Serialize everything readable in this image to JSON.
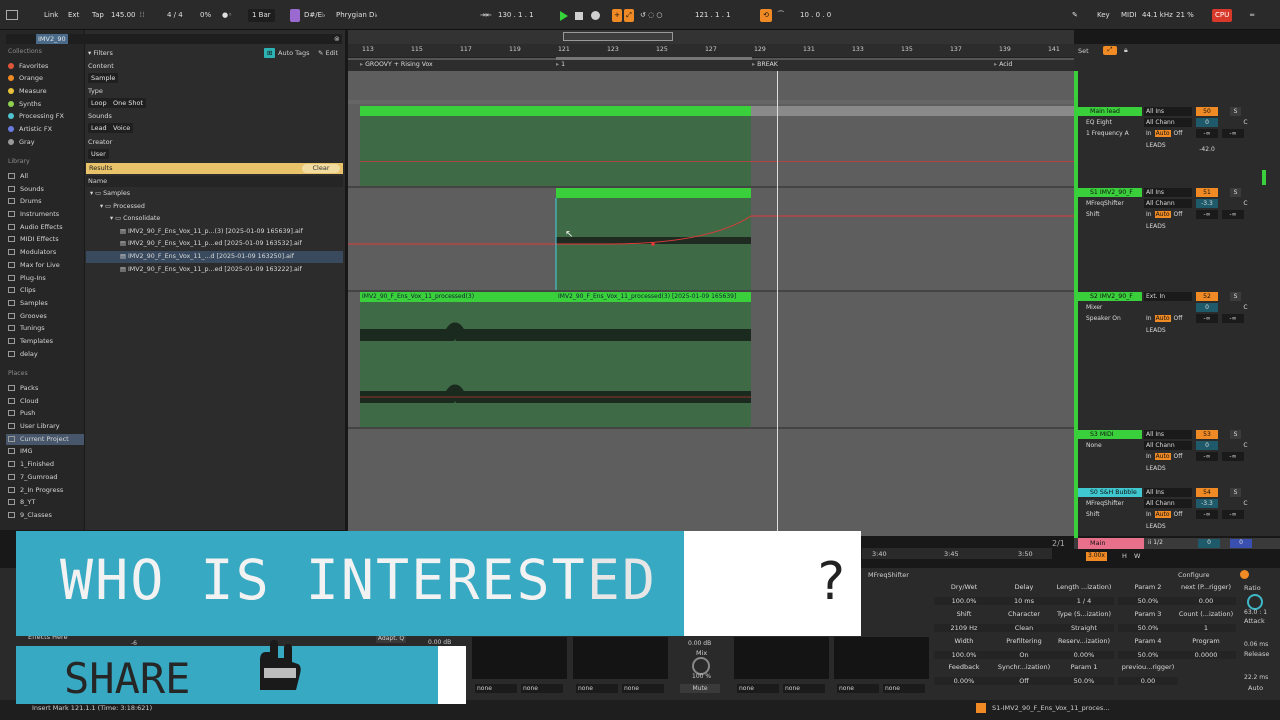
{
  "transport": {
    "link": "Link",
    "ext": "Ext",
    "tap": "Tap",
    "tempo": "145.00",
    "signature": "4 / 4",
    "nudge_pct": "0%",
    "quantize": "1 Bar",
    "scale": "D#/E♭",
    "scale_mode": "Phrygian D♭",
    "position": "130 .  1 .  1",
    "loop_start": "121 .  1 .  1",
    "loop_length": "10 .  0 .  0",
    "key": "Key",
    "midi": "MIDI",
    "sample_rate": "44.1 kHz",
    "cpu_pct": "21 %",
    "cpu": "CPU"
  },
  "browser": {
    "search_value": "IMV2_90",
    "collections_heading": "Collections",
    "collections": [
      {
        "label": "Favorites",
        "color": "#e0563a"
      },
      {
        "label": "Orange",
        "color": "#f08a24"
      },
      {
        "label": "Measure",
        "color": "#e8c33a"
      },
      {
        "label": "Synths",
        "color": "#8fd14f"
      },
      {
        "label": "Processing FX",
        "color": "#4fc3d1"
      },
      {
        "label": "Artistic FX",
        "color": "#6a7ce0"
      },
      {
        "label": "Gray",
        "color": "#9a9a9a"
      }
    ],
    "library_heading": "Library",
    "library": [
      "All",
      "Sounds",
      "Drums",
      "Instruments",
      "Audio Effects",
      "MIDI Effects",
      "Modulators",
      "Max for Live",
      "Plug-Ins",
      "Clips",
      "Samples",
      "Grooves",
      "Tunings",
      "Templates",
      "delay"
    ],
    "places_heading": "Places",
    "places": [
      "Packs",
      "Cloud",
      "Push",
      "User Library",
      "Current Project",
      "IMG",
      "1_Finished",
      "7_Gumroad",
      "2_In Progress",
      "8_YT",
      "9_Classes"
    ],
    "filters_label": "Filters",
    "auto_tags": "Auto Tags",
    "edit": "Edit",
    "content_label": "Content",
    "content_chip": "Sample",
    "type_label": "Type",
    "type_chips": [
      "Loop",
      "One Shot"
    ],
    "sounds_label": "Sounds",
    "sounds_chips": [
      "Lead",
      "Voice"
    ],
    "creator_label": "Creator",
    "creator_chip": "User",
    "results": "Results",
    "clear": "Clear",
    "name_col": "Name",
    "tree": [
      {
        "label": "Samples",
        "indent": 0
      },
      {
        "label": "Processed",
        "indent": 1
      },
      {
        "label": "Consolidate",
        "indent": 2
      },
      {
        "label": "IMV2_90_F_Ens_Vox_11_p...(3) [2025-01-09 165639].aif",
        "indent": 3
      },
      {
        "label": "IMV2_90_F_Ens_Vox_11_p...ed [2025-01-09 163532].aif",
        "indent": 3
      },
      {
        "label": "IMV2_90_F_Ens_Vox_11_...d [2025-01-09 163250].aif",
        "indent": 3
      },
      {
        "label": "IMV2_90_F_Ens_Vox_11_p...ed [2025-01-09 163222].aif",
        "indent": 3
      }
    ]
  },
  "arrangement": {
    "ruler": [
      "113",
      "115",
      "117",
      "119",
      "121",
      "123",
      "125",
      "127",
      "129",
      "131",
      "133",
      "135",
      "137",
      "139",
      "141"
    ],
    "locators": [
      "GROOVY + Rising Vox",
      "1",
      "BREAK",
      "Acid"
    ],
    "time_ruler": [
      "3:40",
      "3:45",
      "3:50"
    ],
    "clip_a": "IMV2_90_F_Ens_Vox_11_processed(3)",
    "clip_b": "IMV2_90_F_Ens_Vox_11_processed(3) [2025-01-09 165639]",
    "zoom_ratio": "2/1"
  },
  "mixer": {
    "set": "Set",
    "tracks": [
      {
        "name": "Main lead",
        "input": "All Ins",
        "channel": "All Chann",
        "device": "EQ Eight",
        "param": "1 Frequency A",
        "volume": "50",
        "send": "0",
        "pan": "C",
        "value": "-42.0",
        "out": "LEADS",
        "inf1": "-∞",
        "inf2": "-∞"
      },
      {
        "name": "S1 IMV2_90_F",
        "input": "All Ins",
        "channel": "All Chann",
        "device": "MFreqShifter",
        "param": "Shift",
        "volume": "51",
        "send": "-3.3",
        "pan": "C",
        "value": "",
        "out": "LEADS",
        "inf1": "-∞",
        "inf2": "-∞"
      },
      {
        "name": "S2 IMV2_90_F",
        "input": "Ext. In",
        "channel": "",
        "device": "Mixer",
        "param": "Speaker On",
        "volume": "52",
        "send": "0",
        "pan": "C",
        "value": "",
        "out": "LEADS",
        "inf1": "-∞",
        "inf2": "-∞"
      },
      {
        "name": "S3 MIDI",
        "input": "All Ins",
        "channel": "All Chann",
        "device": "None",
        "param": "",
        "volume": "53",
        "send": "0",
        "pan": "C",
        "value": "",
        "out": "LEADS",
        "inf1": "-∞",
        "inf2": "-∞"
      },
      {
        "name": "S0 S&H Bubble",
        "input": "All Ins",
        "channel": "All Chann",
        "device": "MFreqShifter",
        "param": "Shift",
        "volume": "54",
        "send": "-3.3",
        "pan": "C",
        "value": "",
        "out": "LEADS",
        "inf1": "-∞",
        "inf2": "-∞"
      }
    ],
    "in": "In",
    "auto": "Auto",
    "off": "Off",
    "main": "Main",
    "main_out": "ii 1/2",
    "main_vol": "0",
    "main_send": "0",
    "zoom": "3.00x",
    "h": "H",
    "w": "W"
  },
  "device": {
    "title": "MFreqShifter",
    "configure": "Configure",
    "params": [
      {
        "label": "Dry/Wet",
        "value": "100.0%"
      },
      {
        "label": "Delay",
        "value": "10 ms"
      },
      {
        "label": "Length ...ization)",
        "value": "1 / 4"
      },
      {
        "label": "Param 2",
        "value": "50.0%"
      },
      {
        "label": "next (P...rigger)",
        "value": "0.00"
      },
      {
        "label": "Shift",
        "value": "2109 Hz"
      },
      {
        "label": "Character",
        "value": "Clean"
      },
      {
        "label": "Type (S...ization)",
        "value": "Straight"
      },
      {
        "label": "Param 3",
        "value": "50.0%"
      },
      {
        "label": "Count (...ization)",
        "value": "1"
      },
      {
        "label": "Width",
        "value": "100.0%"
      },
      {
        "label": "Prefiltering",
        "value": "On"
      },
      {
        "label": "Reserv...ization)",
        "value": "0.00%"
      },
      {
        "label": "Param 4",
        "value": "50.0%"
      },
      {
        "label": "Program",
        "value": "0.0000"
      },
      {
        "label": "Feedback",
        "value": "0.00%"
      },
      {
        "label": "Synchr...ization)",
        "value": "Off"
      },
      {
        "label": "Param 1",
        "value": "50.0%"
      },
      {
        "label": "previou...rigger)",
        "value": "0.00"
      }
    ],
    "ratio_label": "Ratio",
    "ratio": "63.0 : 1",
    "attack_label": "Attack",
    "attack": "0.06 ms",
    "release_label": "Release",
    "release": "22.2 ms",
    "auto": "Auto",
    "effects_here": "Effects Here",
    "adapt_q": "Adapt. Q",
    "mix_db": "0.00 dB",
    "mix_label": "Mix",
    "mix_pct": "100 %",
    "mute": "Mute",
    "neg6": "-6",
    "one_k": "1k",
    "db_val": "0.00 dB",
    "none": "none"
  },
  "status": {
    "left": "Insert Mark 121.1.1 (Time: 3:18:621)",
    "right": "S1-IMV2_90_F_Ens_Vox_11_proces..."
  },
  "overlay": {
    "line1": "WHO IS INTEREST",
    "line1_hidden": "ED",
    "qmark": "?",
    "line2": "SHARE"
  }
}
